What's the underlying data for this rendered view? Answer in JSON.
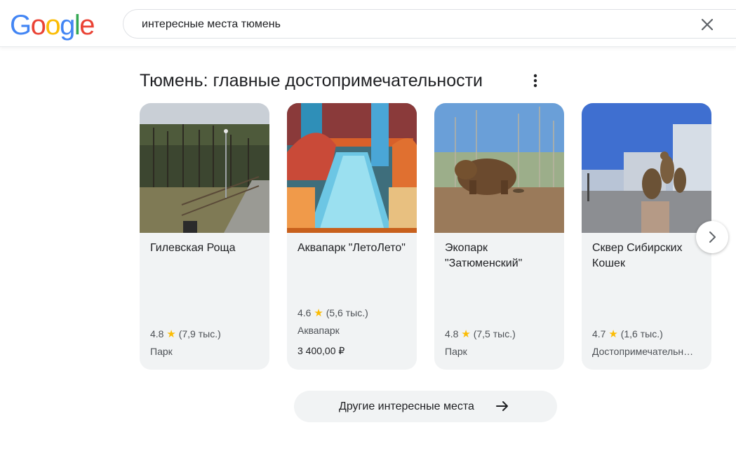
{
  "header": {
    "logo_letters": [
      {
        "char": "G",
        "color": "#4285f4"
      },
      {
        "char": "o",
        "color": "#ea4335"
      },
      {
        "char": "o",
        "color": "#fbbc05"
      },
      {
        "char": "g",
        "color": "#4285f4"
      },
      {
        "char": "l",
        "color": "#34a853"
      },
      {
        "char": "e",
        "color": "#ea4335"
      }
    ],
    "search_value": "интересные места тюмень",
    "clear_icon": "close-icon"
  },
  "section": {
    "title": "Тюмень: главные достопримечательности",
    "menu_icon": "more-vert-icon"
  },
  "cards": [
    {
      "title": "Гилевская Роща",
      "rating": "4.8",
      "reviews": "(7,9 тыс.)",
      "category": "Парк",
      "image": "park-forest-photo"
    },
    {
      "title": "Аквапарк \"ЛетоЛето\"",
      "rating": "4.6",
      "reviews": "(5,6 тыс.)",
      "category": "Аквапарк",
      "price": "3 400,00 ₽",
      "image": "waterpark-slide-photo"
    },
    {
      "title": "Экопарк \"Затюменский\"",
      "rating": "4.8",
      "reviews": "(7,5 тыс.)",
      "category": "Парк",
      "image": "bear-sculpture-photo"
    },
    {
      "title": "Сквер Сибирских Кошек",
      "rating": "4.7",
      "reviews": "(1,6 тыс.)",
      "category": "Достопримечательность",
      "image": "cat-sculptures-photo"
    }
  ],
  "star_glyph": "★",
  "next_icon": "chevron-right-icon",
  "more_places": {
    "label": "Другие интересные места",
    "icon": "arrow-right-icon"
  }
}
